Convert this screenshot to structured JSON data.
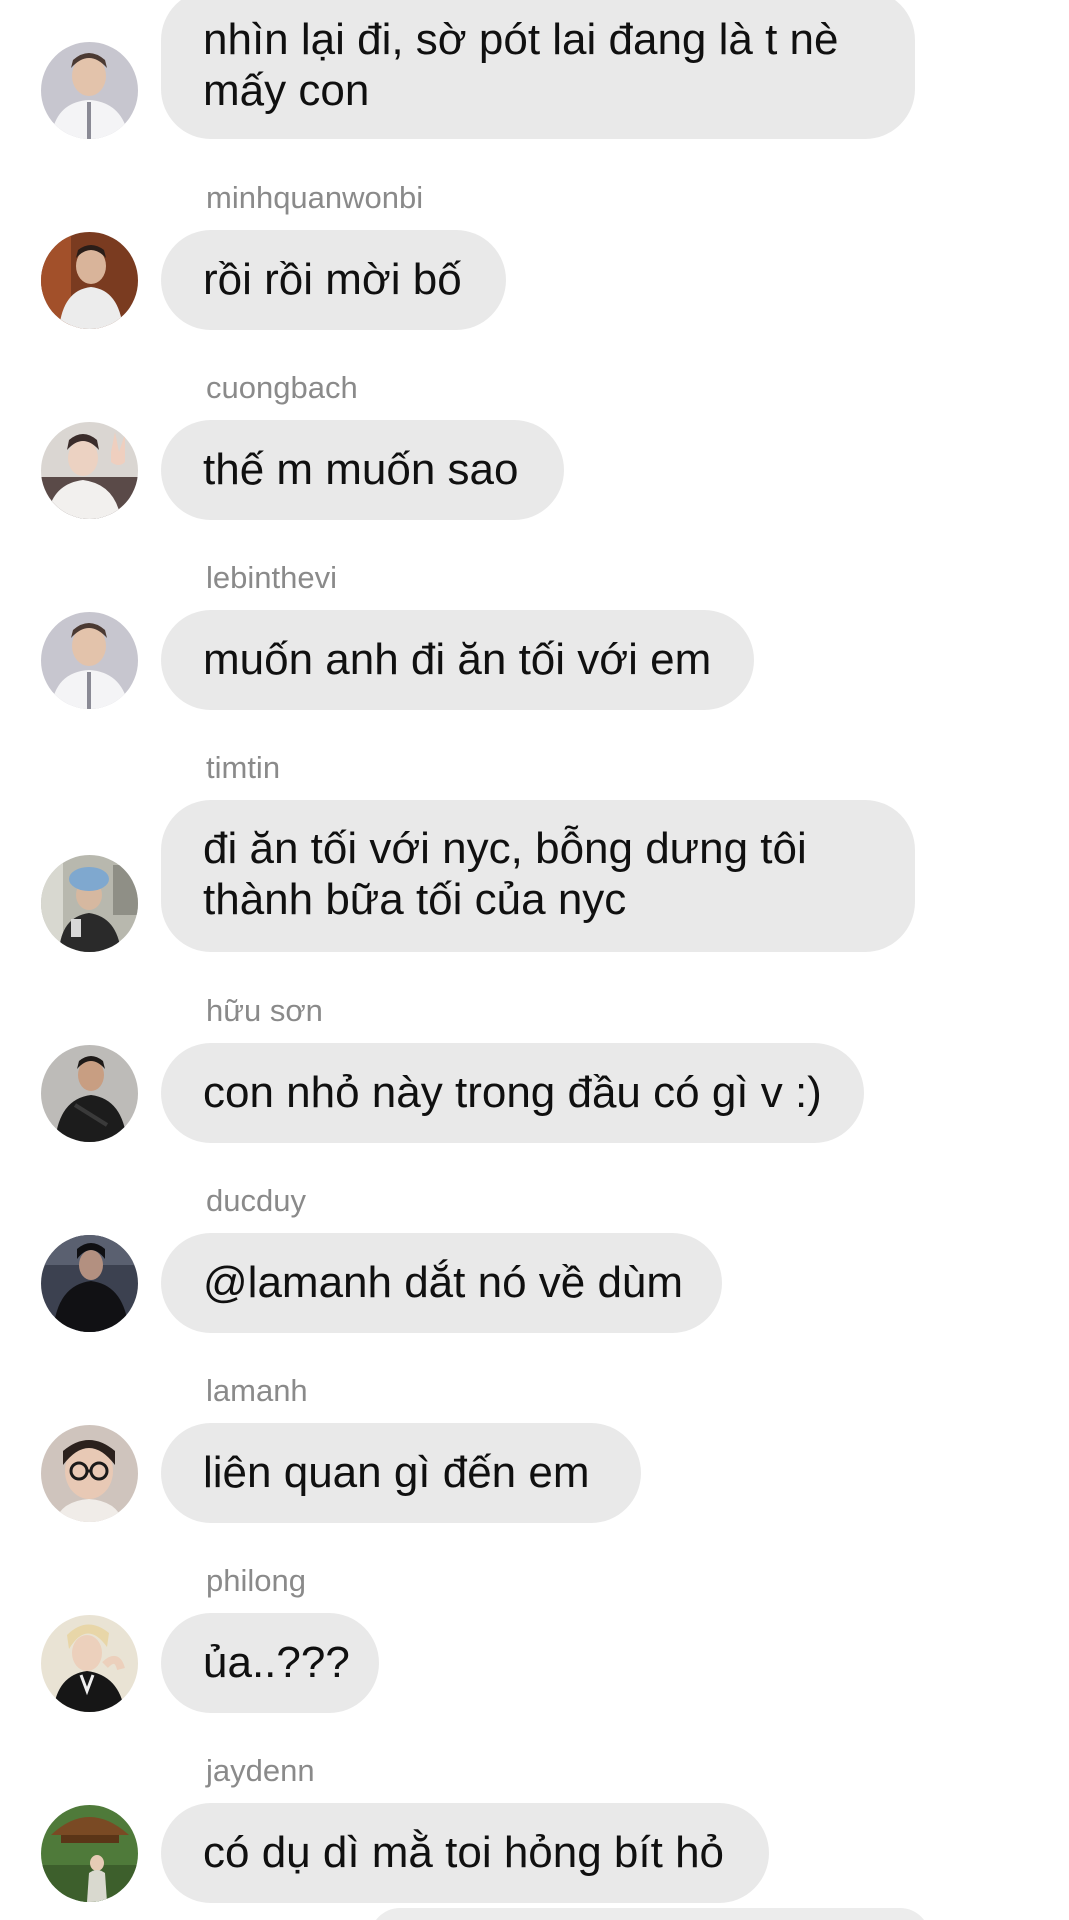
{
  "messages": [
    {
      "sender": "",
      "avatar": "avatar-white-jacket-icon",
      "lines": [
        "nhìn lại đi, sờ pót lai đang là t nè",
        "mấy con"
      ]
    },
    {
      "sender": "minhquanwonbi",
      "avatar": "avatar-brown-room-icon",
      "lines": [
        "rồi rồi mời bố"
      ]
    },
    {
      "sender": "cuongbach",
      "avatar": "avatar-peace-sign-icon",
      "lines": [
        "thế m muốn sao"
      ]
    },
    {
      "sender": "lebinthevi",
      "avatar": "avatar-white-jacket-icon",
      "lines": [
        "muốn anh đi ăn tối với em"
      ]
    },
    {
      "sender": "timtin",
      "avatar": "avatar-blue-hat-icon",
      "lines": [
        "đi ăn tối với nyc, bỗng dưng tôi",
        "thành bữa tối của nyc"
      ]
    },
    {
      "sender": "hữu sơn",
      "avatar": "avatar-dark-outfit-icon",
      "lines": [
        "con nhỏ này trong đầu có gì v :)"
      ]
    },
    {
      "sender": "ducduy",
      "avatar": "avatar-black-hoodie-icon",
      "lines": [
        "@lamanh dắt nó về dùm"
      ]
    },
    {
      "sender": "lamanh",
      "avatar": "avatar-glasses-icon",
      "lines": [
        "liên quan gì đến em"
      ]
    },
    {
      "sender": "philong",
      "avatar": "avatar-blond-hair-icon",
      "lines": [
        "ủa..???"
      ]
    },
    {
      "sender": "jaydenn",
      "avatar": "avatar-garden-icon",
      "lines": [
        "có dụ dì mằ toi hỏng bít hỏ"
      ]
    }
  ],
  "colors": {
    "background": "#ffffff",
    "bubble": "#e9e9e9",
    "sender_text": "#8a8a8a",
    "message_text": "#101010"
  }
}
